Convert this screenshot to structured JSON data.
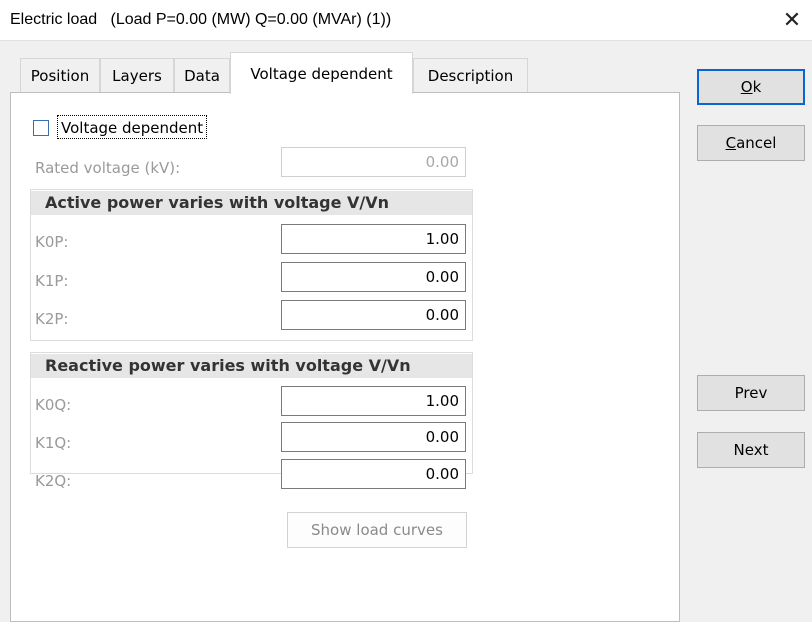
{
  "window": {
    "title": "Electric load   (Load P=0.00 (MW) Q=0.00 (MVAr) (1))",
    "close_glyph": "✕"
  },
  "tabs": [
    {
      "label": "Position",
      "active": false
    },
    {
      "label": "Layers",
      "active": false
    },
    {
      "label": "Data",
      "active": false
    },
    {
      "label": "Voltage dependent",
      "active": true
    },
    {
      "label": "Description",
      "active": false
    }
  ],
  "voltage_dependent": {
    "checkbox_label": "Voltage dependent",
    "checked": false,
    "rated_voltage_label": "Rated voltage (kV):",
    "rated_voltage_value": "0.00"
  },
  "active_power": {
    "header": "Active power varies with voltage V/Vn",
    "rows": [
      {
        "label": "K0P:",
        "value": "1.00"
      },
      {
        "label": "K1P:",
        "value": "0.00"
      },
      {
        "label": "K2P:",
        "value": "0.00"
      }
    ]
  },
  "reactive_power": {
    "header": "Reactive power varies with voltage V/Vn",
    "rows": [
      {
        "label": "K0Q:",
        "value": "1.00"
      },
      {
        "label": "K1Q:",
        "value": "0.00"
      },
      {
        "label": "K2Q:",
        "value": "0.00"
      }
    ]
  },
  "show_curves_label": "Show load curves",
  "buttons": {
    "ok_mnemonic": "O",
    "ok_rest": "k",
    "cancel_mnemonic": "C",
    "cancel_rest": "ancel",
    "prev": "Prev",
    "next": "Next"
  },
  "colors": {
    "accent": "#0a64d6",
    "disabled_text": "#9a9a9a"
  }
}
